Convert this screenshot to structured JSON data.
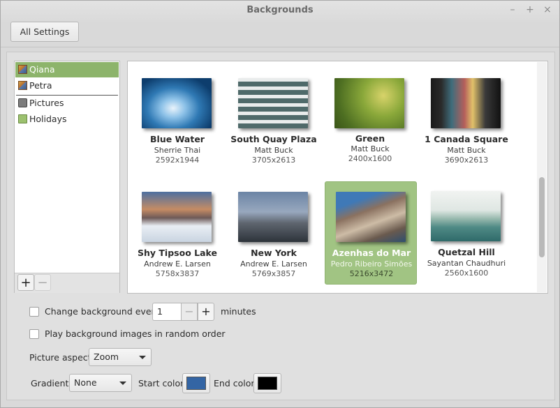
{
  "window": {
    "title": "Backgrounds",
    "controls": {
      "minimize": "–",
      "maximize": "+",
      "close": "×"
    }
  },
  "toolbar": {
    "all_settings_label": "All Settings"
  },
  "sidebar": {
    "items": [
      {
        "label": "Qiana",
        "icon": "image-icon",
        "selected": true
      },
      {
        "label": "Petra",
        "icon": "image-icon",
        "selected": false
      },
      {
        "label": "Pictures",
        "icon": "camera-icon",
        "selected": false
      },
      {
        "label": "Holidays",
        "icon": "folder-icon",
        "selected": false
      }
    ],
    "add_label": "+",
    "remove_label": "−"
  },
  "gallery": {
    "wallpapers": [
      {
        "name": "Blue Water",
        "author": "Sherrie Thai",
        "resolution": "2592x1944"
      },
      {
        "name": "South Quay Plaza",
        "author": "Matt Buck",
        "resolution": "3705x2613"
      },
      {
        "name": "Green",
        "author": "Matt Buck",
        "resolution": "2400x1600"
      },
      {
        "name": "1 Canada Square",
        "author": "Matt Buck",
        "resolution": "3690x2613"
      },
      {
        "name": "Shy Tipsoo Lake",
        "author": "Andrew E. Larsen",
        "resolution": "5758x3837"
      },
      {
        "name": "New York",
        "author": "Andrew E. Larsen",
        "resolution": "5769x3857"
      },
      {
        "name": "Azenhas do Mar",
        "author": "Pedro Ribeiro Simões",
        "resolution": "5216x3472",
        "selected": true
      },
      {
        "name": "Quetzal Hill",
        "author": "Sayantan Chaudhuri",
        "resolution": "2560x1600"
      }
    ]
  },
  "options": {
    "change_every_label": "Change background every",
    "interval_value": "1",
    "minus_label": "−",
    "plus_label": "+",
    "minutes_label": "minutes",
    "random_order_label": "Play background images in random order",
    "picture_aspect_label": "Picture aspect",
    "picture_aspect_value": "Zoom",
    "gradient_label": "Gradient",
    "gradient_value": "None",
    "start_color_label": "Start color",
    "start_color": "#3465a4",
    "end_color_label": "End color",
    "end_color": "#000000"
  },
  "colors": {
    "accent_selection": "#8db46b"
  }
}
